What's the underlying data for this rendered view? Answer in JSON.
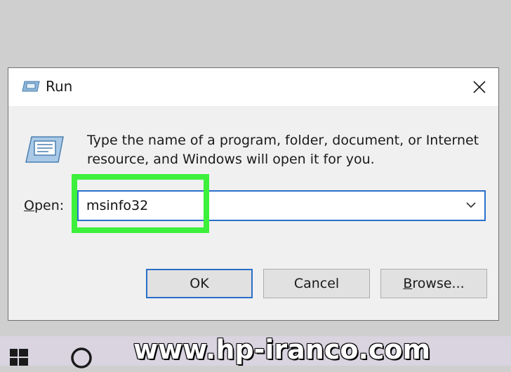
{
  "dialog": {
    "title": "Run",
    "description": "Type the name of a program, folder, document, or Internet resource, and Windows will open it for you.",
    "open_label_accel": "O",
    "open_label_rest": "pen:",
    "open_value": "msinfo32",
    "buttons": {
      "ok": "OK",
      "cancel": "Cancel",
      "browse_accel": "B",
      "browse_rest": "rowse..."
    }
  },
  "watermark": "www.hp-iranco.com",
  "colors": {
    "highlight": "#3cf03c",
    "focus_border": "#2a6fc9"
  },
  "icons": [
    "run-app-icon",
    "close-icon",
    "chevron-down-icon",
    "windows-start-icon",
    "search-circle-icon"
  ]
}
